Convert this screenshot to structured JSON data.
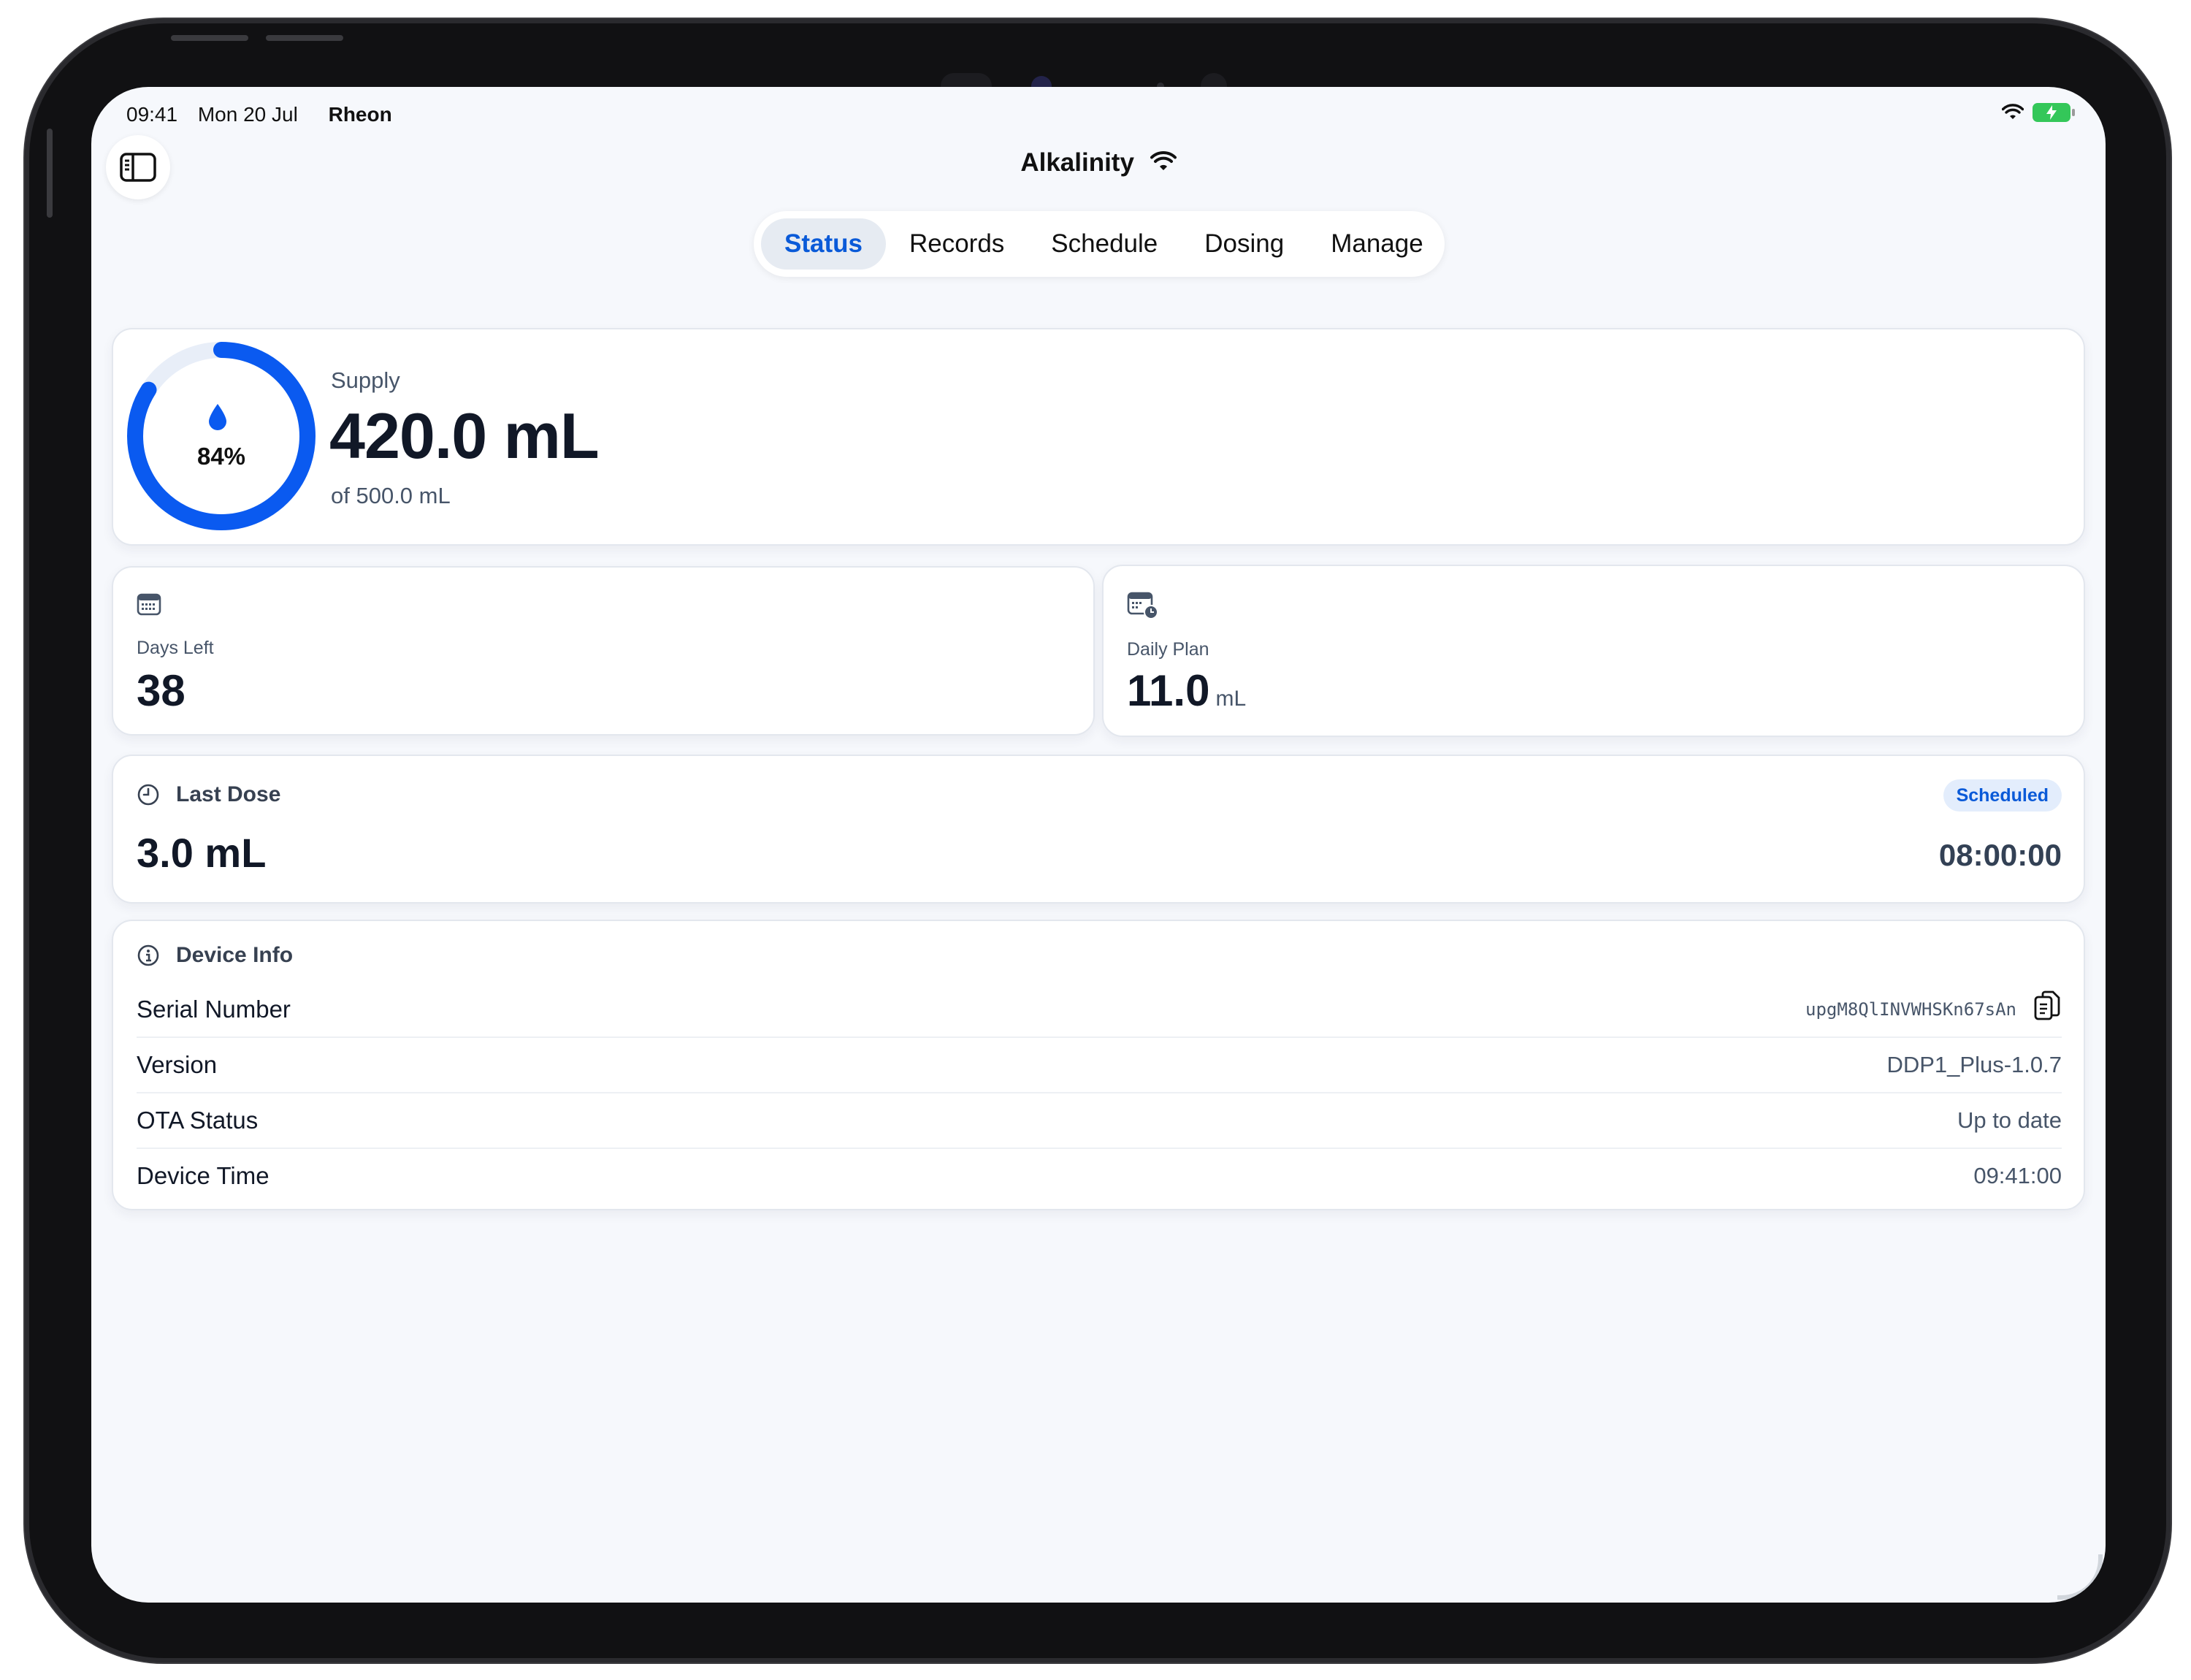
{
  "status_bar": {
    "time": "09:41",
    "date": "Mon 20 Jul",
    "carrier": "Rheon"
  },
  "header": {
    "title": "Alkalinity",
    "connection_icon": "wifi-icon"
  },
  "tabs": [
    {
      "label": "Status",
      "active": true
    },
    {
      "label": "Records",
      "active": false
    },
    {
      "label": "Schedule",
      "active": false
    },
    {
      "label": "Dosing",
      "active": false
    },
    {
      "label": "Manage",
      "active": false
    }
  ],
  "supply": {
    "label": "Supply",
    "value": "420.0 mL",
    "capacity": "of 500.0 mL",
    "percent_text": "84%",
    "percent": 84
  },
  "days_left": {
    "label": "Days Left",
    "value": "38"
  },
  "daily_plan": {
    "label": "Daily Plan",
    "value": "11.0",
    "unit": "mL"
  },
  "last_dose": {
    "label": "Last Dose",
    "value": "3.0 mL",
    "badge": "Scheduled",
    "time": "08:00:00"
  },
  "device_info": {
    "label": "Device Info",
    "rows": [
      {
        "label": "Serial Number",
        "value": "upgM8QlINVWHSKn67sAn"
      },
      {
        "label": "Version",
        "value": "DDP1_Plus-1.0.7"
      },
      {
        "label": "OTA Status",
        "value": "Up to date"
      },
      {
        "label": "Device Time",
        "value": "09:41:00"
      }
    ]
  },
  "colors": {
    "accent": "#0a5ad8",
    "ring": "#0a5af0",
    "ring_track": "#e8eef8",
    "battery": "#34c759"
  }
}
